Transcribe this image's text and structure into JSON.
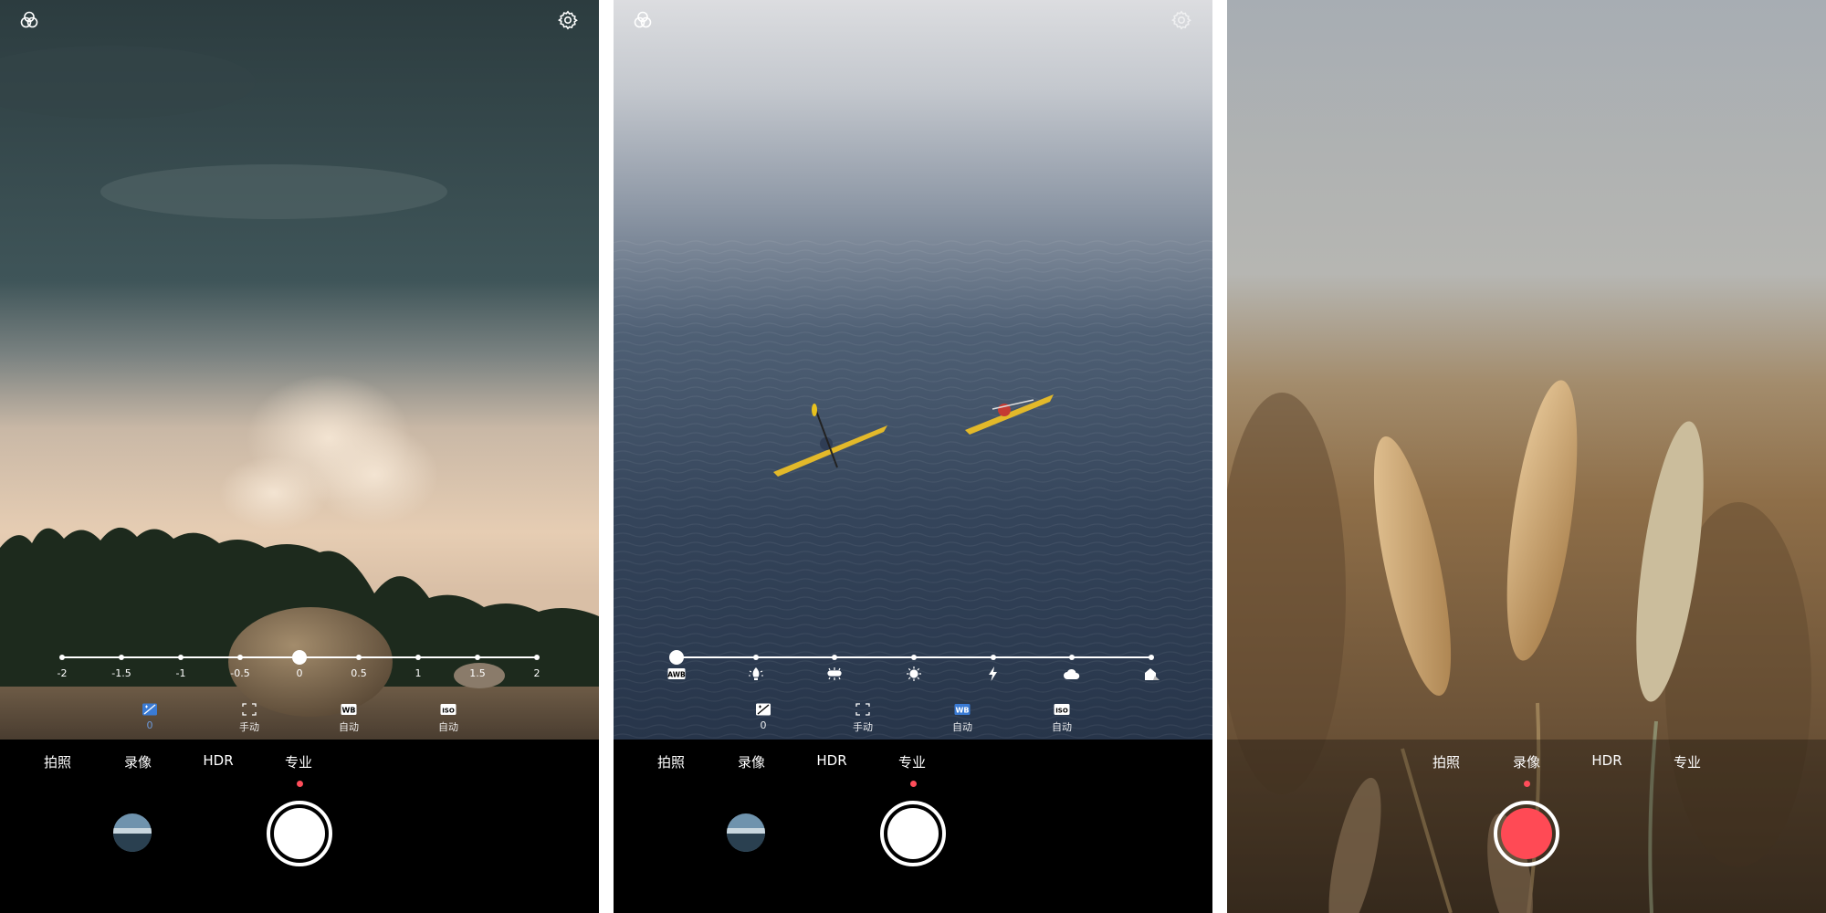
{
  "colors": {
    "accent_dot": "#ff4d5a",
    "record_button": "#ff4a55",
    "active_control": "#3a7bd5"
  },
  "top_icons": {
    "left": "filter-icon",
    "right": "settings-icon"
  },
  "modes": [
    "拍照",
    "录像",
    "HDR",
    "专业"
  ],
  "panels": [
    {
      "active_mode": "专业",
      "exposure_slider": {
        "ticks": [
          "-2",
          "-1.5",
          "-1",
          "-0.5",
          "0",
          "0.5",
          "1",
          "1.5",
          "2"
        ],
        "selected_value": "0"
      },
      "controls": [
        {
          "icon": "exposure-icon",
          "label": "0",
          "active": true
        },
        {
          "icon": "focus-icon",
          "label": "手动",
          "active": false
        },
        {
          "icon": "wb-badge",
          "badge": "WB",
          "label": "自动",
          "active": false
        },
        {
          "icon": "iso-badge",
          "badge": "ISO",
          "label": "自动",
          "active": false
        }
      ]
    },
    {
      "active_mode": "专业",
      "white_balance_slider": {
        "presets": [
          "AWB",
          "incandescent-icon",
          "fluorescent-icon",
          "daylight-icon",
          "flash-icon",
          "cloudy-icon",
          "shade-icon"
        ],
        "selected_index": 0,
        "awb_label": "AWB"
      },
      "controls": [
        {
          "icon": "exposure-icon",
          "label": "0",
          "active": false
        },
        {
          "icon": "focus-icon",
          "label": "手动",
          "active": false
        },
        {
          "icon": "wb-badge",
          "badge": "WB",
          "label": "自动",
          "active": true
        },
        {
          "icon": "iso-badge",
          "badge": "ISO",
          "label": "自动",
          "active": false
        }
      ]
    },
    {
      "active_mode": "录像",
      "recording": true
    }
  ]
}
